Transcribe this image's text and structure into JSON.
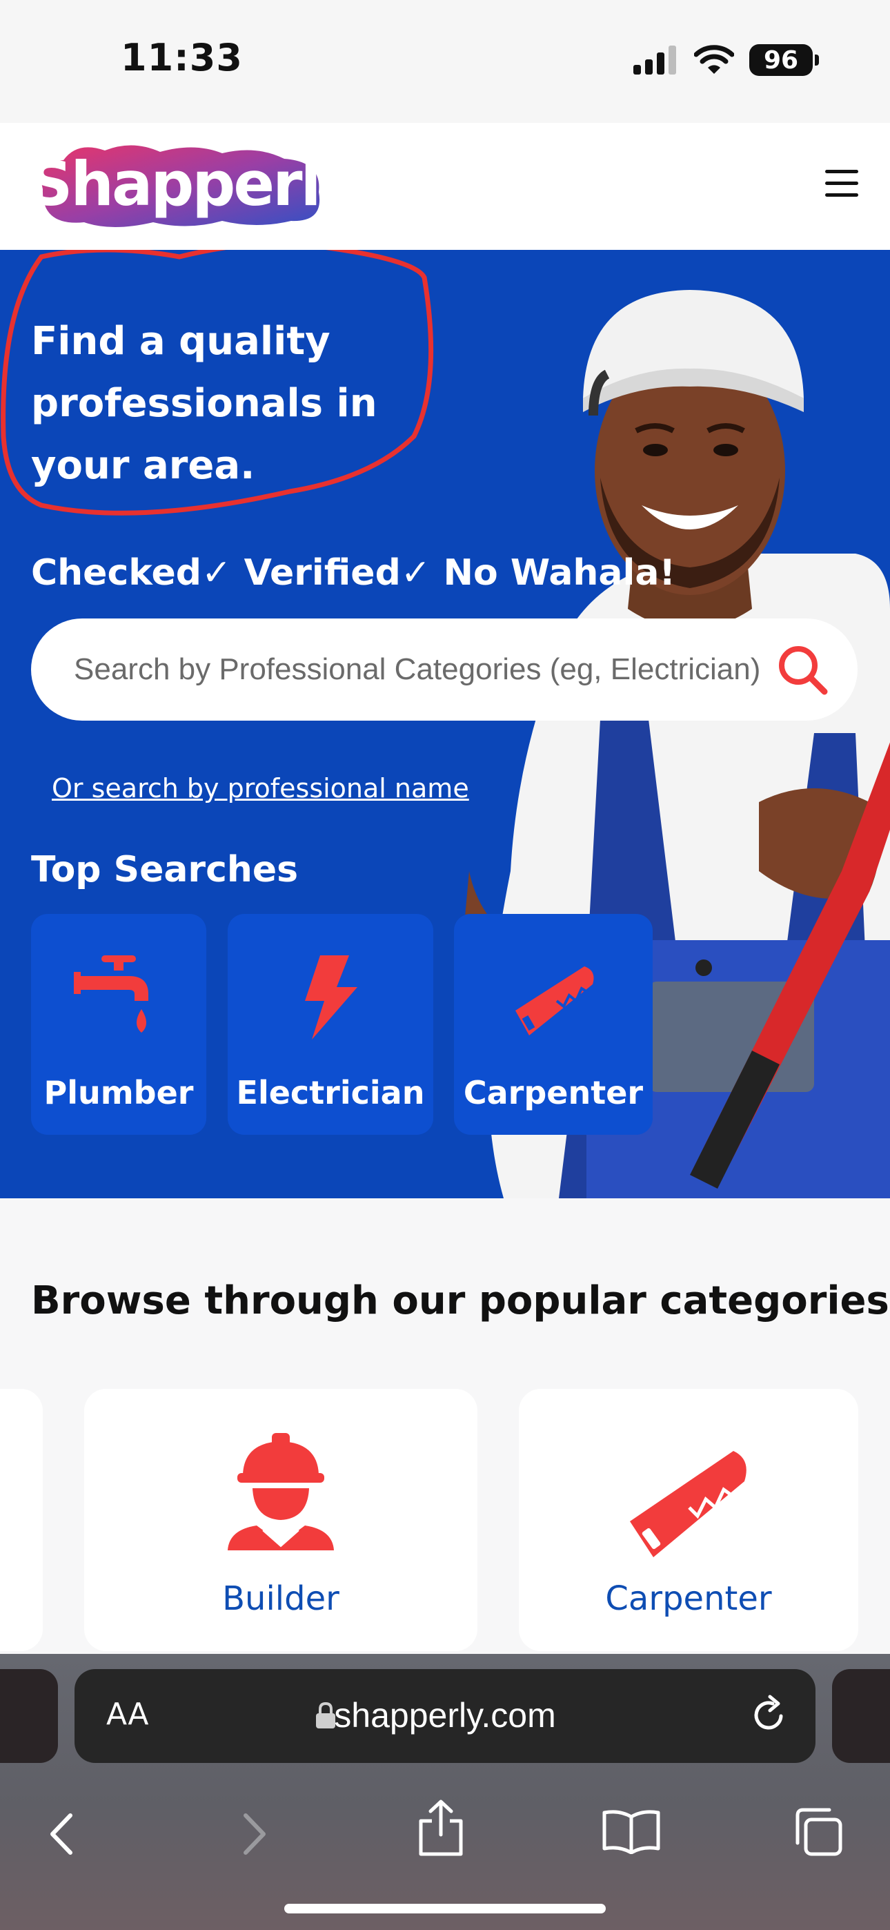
{
  "status_bar": {
    "time": "11:33",
    "battery": "96"
  },
  "header": {
    "logo": "Shapperly"
  },
  "hero": {
    "title": "Find a quality professionals in your area.",
    "subtitle": "Checked✓ Verified✓ No Wahala!",
    "search_placeholder": "Search by Professional Categories (eg, Electrician)",
    "name_search_link": "Or search by professional name",
    "top_searches_title": "Top Searches",
    "top_searches": [
      {
        "label": "Plumber",
        "icon": "faucet-icon"
      },
      {
        "label": "Electrician",
        "icon": "lightning-icon"
      },
      {
        "label": "Carpenter",
        "icon": "saw-icon"
      }
    ]
  },
  "categories": {
    "title": "Browse through our popular categories",
    "items": [
      {
        "label": "Builder",
        "icon": "builder-icon"
      },
      {
        "label": "Carpenter",
        "icon": "saw-icon"
      }
    ]
  },
  "browser": {
    "text_size": "AA",
    "url": "shapperly.com"
  },
  "colors": {
    "hero_blue": "#0b46b8",
    "chip_blue": "#0d4fd0",
    "accent_red": "#f23c3c",
    "category_label": "#0e4db3"
  }
}
